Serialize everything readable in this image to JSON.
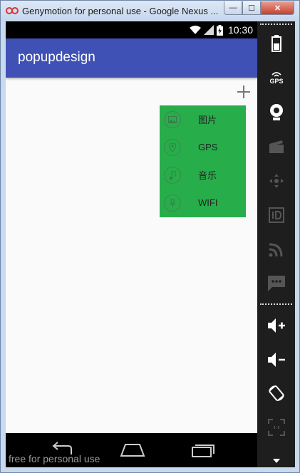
{
  "window": {
    "title": "Genymotion for personal use - Google Nexus ...",
    "min_symbol": "—",
    "max_symbol": "☐",
    "close_symbol": "✕"
  },
  "statusbar": {
    "time": "10:30",
    "icons": [
      "wifi-icon",
      "signal-icon",
      "battery-charging-icon"
    ]
  },
  "app": {
    "title": "popupdesign",
    "add_icon": "plus-icon"
  },
  "popup": {
    "background": "#27ae4a",
    "items": [
      {
        "label": "图片",
        "icon": "image-icon"
      },
      {
        "label": "GPS",
        "icon": "location-pin-icon"
      },
      {
        "label": "音乐",
        "icon": "music-note-icon"
      },
      {
        "label": "WIFI",
        "icon": "microphone-icon"
      }
    ]
  },
  "navbar": {
    "buttons": [
      "back-icon",
      "home-icon",
      "recents-icon"
    ],
    "watermark": "free for personal use"
  },
  "sidebar": {
    "gps_label": "GPS",
    "items": [
      "battery-icon",
      "gps-icon",
      "webcam-icon",
      "video-clapper-icon",
      "dpad-icon",
      "id-icon",
      "rss-icon",
      "sms-icon",
      "volume-up-icon",
      "volume-down-icon",
      "rotate-icon",
      "scale-icon"
    ]
  },
  "colors": {
    "appbar": "#3f51b5",
    "popup": "#27ae4a",
    "status_bar": "#000000"
  }
}
